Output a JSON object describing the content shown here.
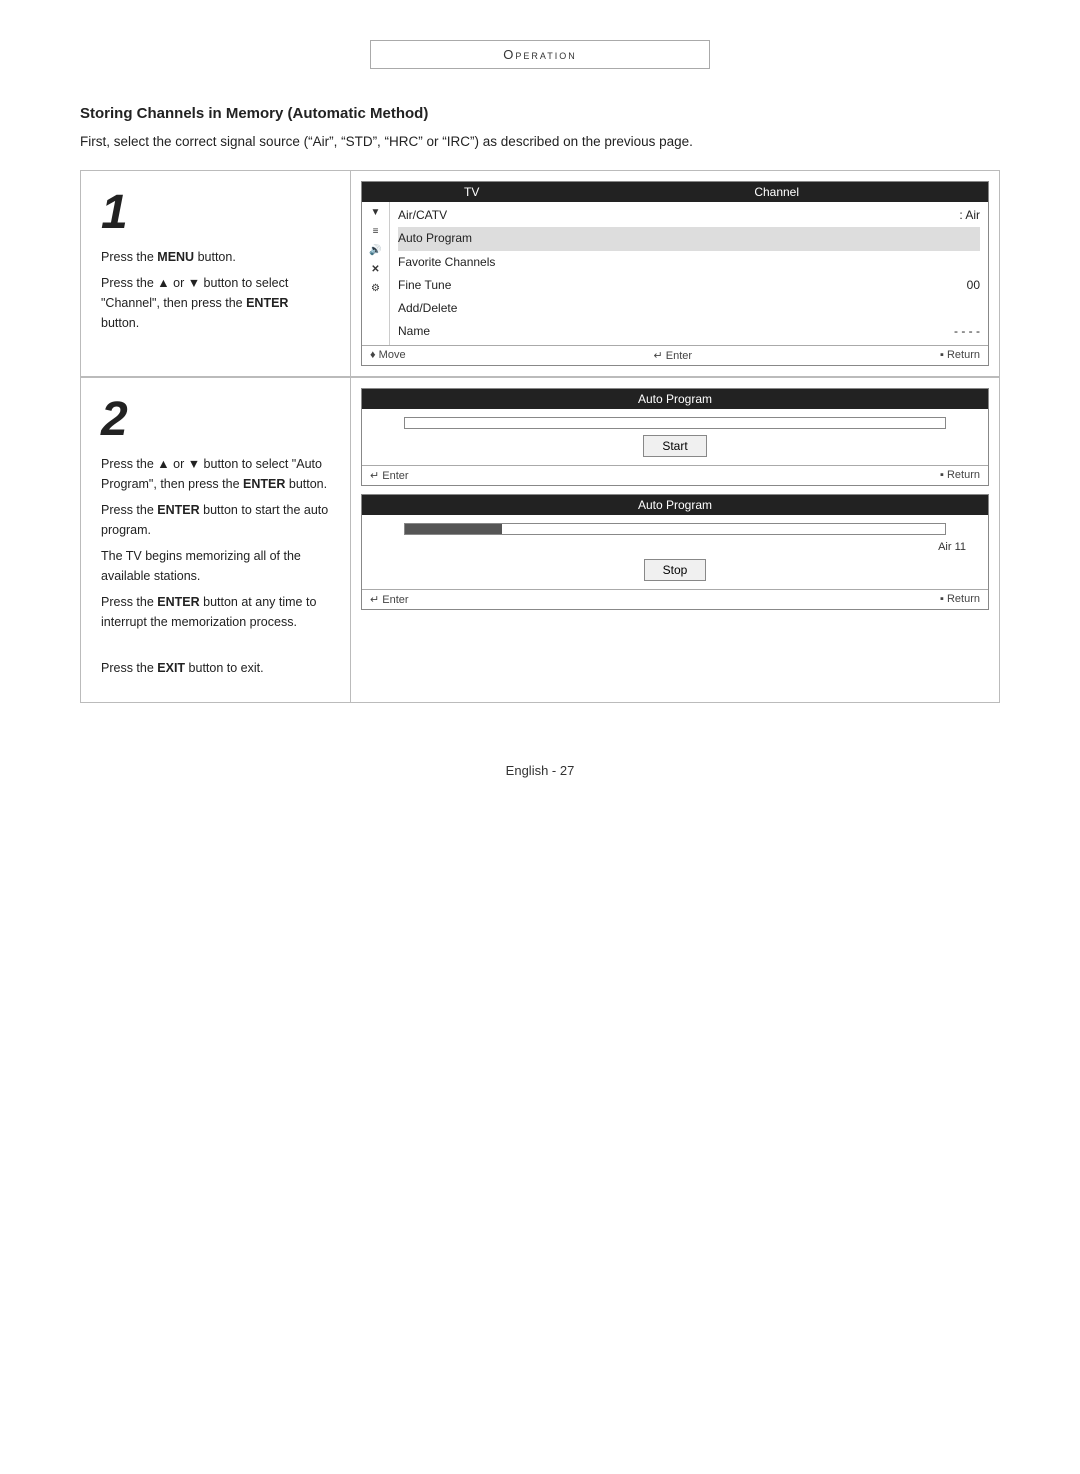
{
  "header": {
    "title": "Operation"
  },
  "section": {
    "title": "Storing Channels in Memory (Automatic Method)",
    "intro": "First, select the correct signal source (“Air”, “STD”, “HRC” or “IRC”) as described on the previous page."
  },
  "step1": {
    "number": "1",
    "instructions": [
      "Press the MENU button.",
      "Press the  or  button to select “Channel”, then press the ENTER button."
    ]
  },
  "step2": {
    "number": "2",
    "instructions": [
      "Press the  or  button to select “Auto Program”, then press the ENTER button.",
      "Press the ENTER button to start the auto program.",
      "The TV begins memorizing all of the available stations.",
      "Press the ENTER button at any time to interrupt the memorization process.",
      "Press the EXIT button to exit."
    ]
  },
  "channel_menu": {
    "header_tv": "TV",
    "header_channel": "Channel",
    "items": [
      {
        "label": "Air/CATV",
        "value": ":  Air"
      },
      {
        "label": "Auto Program",
        "value": ""
      },
      {
        "label": "Favorite Channels",
        "value": ""
      },
      {
        "label": "Fine Tune",
        "value": "00"
      },
      {
        "label": "Add/Delete",
        "value": ""
      },
      {
        "label": "Name",
        "value": "- - - -"
      }
    ],
    "footer_move": "◆Move",
    "footer_enter": "↵Enter",
    "footer_return": "■Return"
  },
  "auto_program_screen1": {
    "header": "Auto Program",
    "button_label": "Start",
    "footer_enter": "↵Enter",
    "footer_return": "■Return"
  },
  "auto_program_screen2": {
    "header": "Auto Program",
    "channel_info": "Air  11",
    "button_label": "Stop",
    "footer_enter": "↵Enter",
    "footer_return": "■Return"
  },
  "footer": {
    "page_label": "English - 27"
  }
}
